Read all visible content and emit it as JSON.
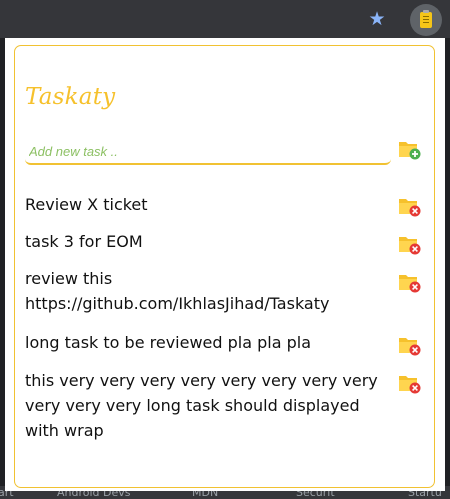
{
  "app": {
    "title": "Taskaty",
    "input_placeholder": "Add new task ..",
    "input_value": ""
  },
  "toolbar": {
    "bookmark_icon": "star-icon",
    "extension_icon": "clipboard-icon"
  },
  "bookmarks": [
    "art",
    "Android Devs",
    "MDN",
    "Securit",
    "Startu"
  ],
  "icons": {
    "add": "folder-add-icon",
    "delete": "folder-delete-icon"
  },
  "colors": {
    "accent": "#f6c12c",
    "input_text": "#8cc063",
    "add_badge": "#4caf50",
    "delete_badge": "#e53935"
  },
  "tasks": [
    {
      "text": "Review X ticket"
    },
    {
      "text": "task 3 for EOM"
    },
    {
      "text": "review this https://github.com/IkhlasJihad/Taskaty"
    },
    {
      "text": "long task to be reviewed pla pla pla"
    },
    {
      "text": "this very very very very very very very very very very very long task should displayed with wrap"
    }
  ]
}
